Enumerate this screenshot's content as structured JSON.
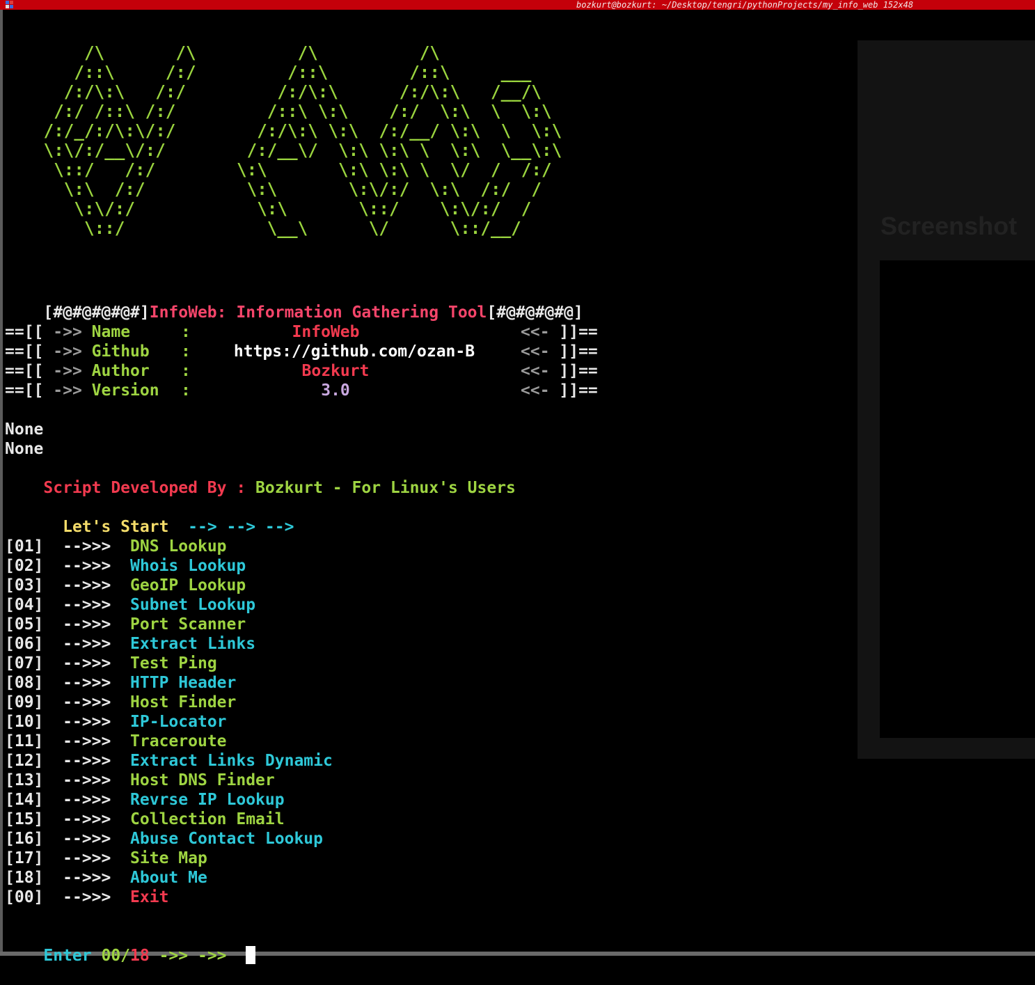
{
  "window": {
    "title": "bozkurt@bozkurt: ~/Desktop/tengri/pythonProjects/my_info_web 152x48"
  },
  "banner_ascii": "     /\\       /\\          /\\          /\\\n    /::\\     /:/         /::\\        /::\\     ___\n   /:/\\:\\   /:/         /:/\\:\\      /:/\\:\\   /__/\\\n  /:/ /::\\ /:/         /::\\ \\:\\    /:/  \\:\\  \\  \\:\\\n /:/_/:/\\:\\/:/        /:/\\:\\ \\:\\  /:/__/ \\:\\  \\  \\:\\\n \\:\\/:/__\\/:/        /:/__\\/  \\:\\ \\:\\ \\  \\:\\  \\__\\:\\\n  \\::/   /:/        \\:\\       \\:\\ \\:\\ \\  \\/  /  /:/\n   \\:\\  /:/          \\:\\       \\:\\/:/  \\:\\  /:/  /\n    \\:\\/:/            \\:\\       \\::/    \\:\\/:/  /\n     \\::/              \\__\\      \\/      \\::/__/",
  "header": {
    "prefix": "[#@#@#@#@#]",
    "title": "InfoWeb: Information Gathering Tool",
    "suffix": "[#@#@#@#@]"
  },
  "info_rows": [
    {
      "key": "Name",
      "value": "InfoWeb",
      "color": "#f23a4f"
    },
    {
      "key": "Github",
      "value": "https://github.com/ozan-B",
      "color": "#ffffff"
    },
    {
      "key": "Author",
      "value": "Bozkurt",
      "color": "#f23a4f"
    },
    {
      "key": "Version",
      "value": "3.0",
      "color": "#c9a8e0"
    }
  ],
  "info_decor": {
    "left": "==[[ ",
    "arrow": "->>",
    "sep": ":",
    "right_arrow": "<<-",
    "right": " ]]=="
  },
  "none_lines": [
    "None",
    "None"
  ],
  "developer": {
    "label": "Script Developed By : ",
    "name": "Bozkurt - For Linux's Users"
  },
  "start": {
    "label": "Let's Start",
    "arrows": "--> --> -->"
  },
  "menu_arrow": "-->>>",
  "menu": [
    {
      "num": "[01]",
      "label": "DNS Lookup",
      "color": "#9ed442"
    },
    {
      "num": "[02]",
      "label": "Whois Lookup",
      "color": "#2ec8d8"
    },
    {
      "num": "[03]",
      "label": "GeoIP Lookup",
      "color": "#9ed442"
    },
    {
      "num": "[04]",
      "label": "Subnet Lookup",
      "color": "#2ec8d8"
    },
    {
      "num": "[05]",
      "label": "Port Scanner",
      "color": "#9ed442"
    },
    {
      "num": "[06]",
      "label": "Extract Links",
      "color": "#2ec8d8"
    },
    {
      "num": "[07]",
      "label": "Test Ping",
      "color": "#9ed442"
    },
    {
      "num": "[08]",
      "label": "HTTP Header",
      "color": "#2ec8d8"
    },
    {
      "num": "[09]",
      "label": "Host Finder",
      "color": "#9ed442"
    },
    {
      "num": "[10]",
      "label": "IP-Locator",
      "color": "#2ec8d8"
    },
    {
      "num": "[11]",
      "label": "Traceroute",
      "color": "#9ed442"
    },
    {
      "num": "[12]",
      "label": "Extract Links Dynamic",
      "color": "#2ec8d8"
    },
    {
      "num": "[13]",
      "label": "Host DNS Finder",
      "color": "#9ed442"
    },
    {
      "num": "[14]",
      "label": "Revrse IP Lookup",
      "color": "#2ec8d8"
    },
    {
      "num": "[15]",
      "label": "Collection Email",
      "color": "#9ed442"
    },
    {
      "num": "[16]",
      "label": "Abuse Contact Lookup",
      "color": "#2ec8d8"
    },
    {
      "num": "[17]",
      "label": "Site Map",
      "color": "#9ed442"
    },
    {
      "num": "[18]",
      "label": "About Me",
      "color": "#2ec8d8"
    },
    {
      "num": "[00]",
      "label": "Exit",
      "color": "#f23a4f"
    }
  ],
  "prompt": {
    "enter": "Enter ",
    "range_a": "00/",
    "range_b": "18",
    "arrows": " ->> ->> "
  },
  "background_ghost": {
    "big_word": "Screenshot"
  }
}
